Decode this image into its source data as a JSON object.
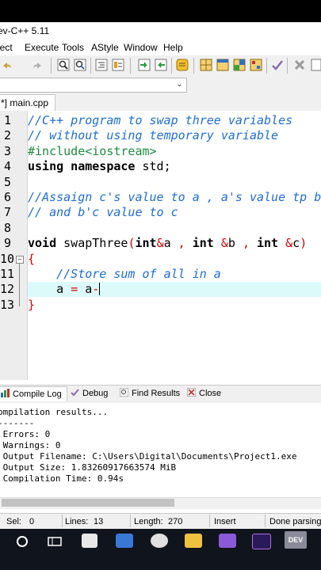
{
  "window": {
    "title": "ev-C++ 5.11"
  },
  "menu": [
    "ject",
    "Execute",
    "Tools",
    "AStyle",
    "Window",
    "Help"
  ],
  "toolbar": {
    "icons": [
      "undo-icon",
      "redo-icon",
      "search-icon",
      "replace-icon",
      "indent-icon",
      "unindent-icon",
      "goto-icon",
      "bookmark-icon",
      "compile-icon",
      "grid-view-icon",
      "split-view-icon",
      "layout-icon",
      "tile-icon",
      "check-icon",
      "close-project-icon",
      "delete-icon"
    ]
  },
  "dropdown": {
    "arrow": "⌄"
  },
  "editor": {
    "tab_label": "*] main.cpp",
    "lines": [
      {
        "n": "1",
        "parts": [
          {
            "c": "cmt",
            "t": "//C++ program to swap three variables"
          }
        ]
      },
      {
        "n": "2",
        "parts": [
          {
            "c": "cmt",
            "t": "// without using temporary variable"
          }
        ]
      },
      {
        "n": "3",
        "parts": [
          {
            "c": "pre",
            "t": "#include<iostream>"
          }
        ]
      },
      {
        "n": "4",
        "parts": [
          {
            "c": "kw",
            "t": "using namespace "
          },
          {
            "c": "txt",
            "t": "std;"
          }
        ]
      },
      {
        "n": "5",
        "parts": []
      },
      {
        "n": "6",
        "parts": [
          {
            "c": "cmt",
            "t": "//Assaign c's value to a , a's value tp b"
          }
        ]
      },
      {
        "n": "7",
        "parts": [
          {
            "c": "cmt",
            "t": "// and b'c value to c"
          }
        ]
      },
      {
        "n": "8",
        "parts": []
      },
      {
        "n": "9",
        "parts": [
          {
            "c": "kw",
            "t": "void "
          },
          {
            "c": "txt",
            "t": "swapThree"
          },
          {
            "c": "red",
            "t": "("
          },
          {
            "c": "kw",
            "t": "int"
          },
          {
            "c": "red",
            "t": "&"
          },
          {
            "c": "txt",
            "t": "a "
          },
          {
            "c": "red",
            "t": ", "
          },
          {
            "c": "kw",
            "t": "int "
          },
          {
            "c": "red",
            "t": "&"
          },
          {
            "c": "txt",
            "t": "b "
          },
          {
            "c": "red",
            "t": ", "
          },
          {
            "c": "kw",
            "t": "int "
          },
          {
            "c": "red",
            "t": "&"
          },
          {
            "c": "txt",
            "t": "c"
          },
          {
            "c": "red",
            "t": ")"
          }
        ]
      },
      {
        "n": "10",
        "parts": [
          {
            "c": "red",
            "t": "{"
          }
        ]
      },
      {
        "n": "11",
        "parts": [
          {
            "c": "txt",
            "t": "    "
          },
          {
            "c": "cmt",
            "t": "//Store sum of all in a"
          }
        ]
      },
      {
        "n": "12",
        "parts": [
          {
            "c": "txt",
            "t": "    a "
          },
          {
            "c": "red",
            "t": "= "
          },
          {
            "c": "txt",
            "t": "a"
          },
          {
            "c": "red",
            "t": "-"
          }
        ]
      },
      {
        "n": "13",
        "parts": [
          {
            "c": "red",
            "t": "}"
          }
        ]
      }
    ]
  },
  "panel": {
    "tabs": [
      "Compile Log",
      "Debug",
      "Find Results",
      "Close"
    ],
    "log": [
      "ompilation results...",
      "-------",
      " Errors: 0",
      " Warnings: 0",
      " Output Filename: C:\\Users\\Digital\\Documents\\Project1.exe",
      " Output Size: 1.83260917663574 MiB",
      " Compilation Time: 0.94s"
    ]
  },
  "status": {
    "sel_label": "Sel:",
    "sel_value": "0",
    "lines_label": "Lines:",
    "lines_value": "13",
    "length_label": "Length:",
    "length_value": "270",
    "mode": "Insert",
    "message": "Done parsing"
  },
  "taskbar": {
    "dev_label": "DEV"
  },
  "colors": {
    "comment": "#1e6dd6",
    "preprocessor": "#1c8a3c",
    "operator": "#d40000",
    "current_line": "#dcfafa"
  }
}
